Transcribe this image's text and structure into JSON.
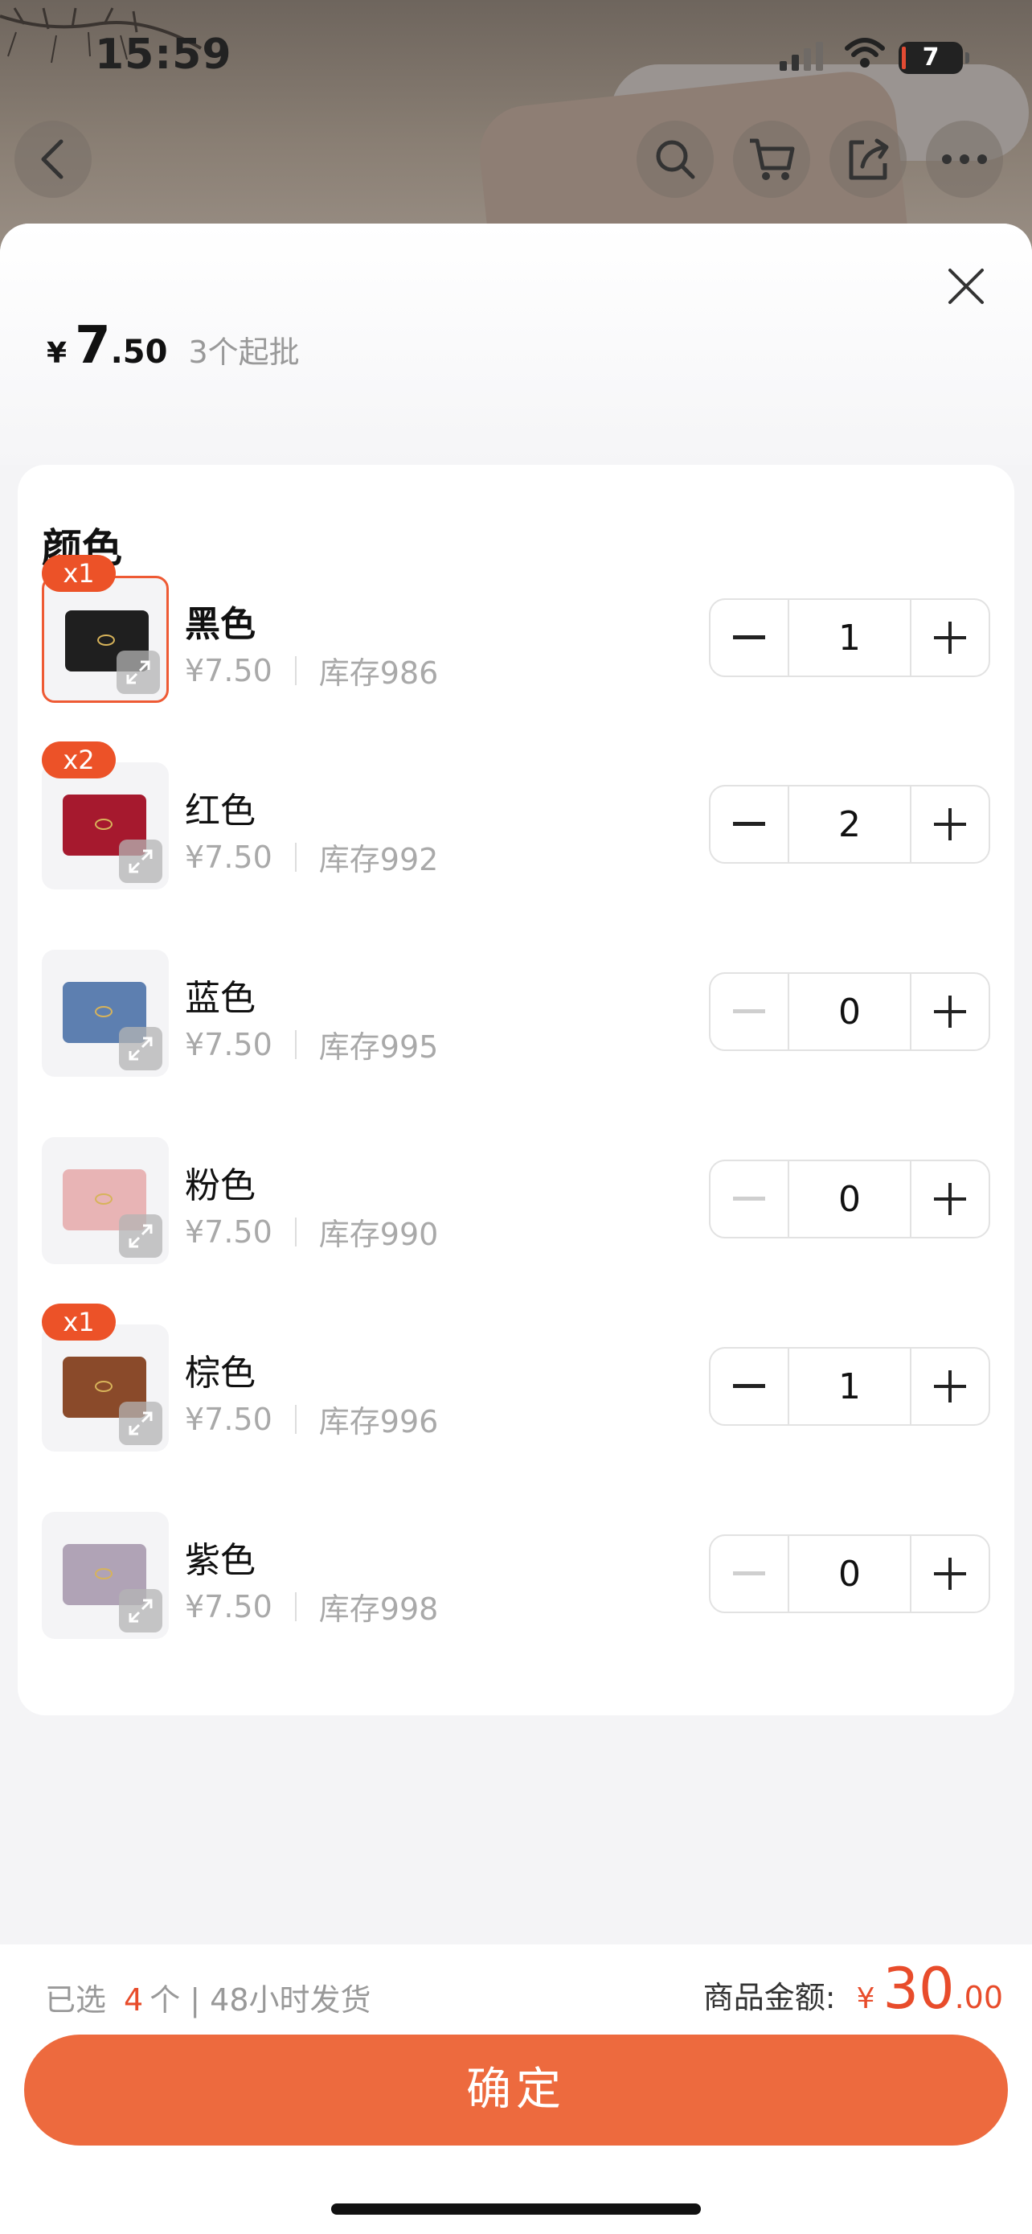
{
  "status_bar": {
    "time": "15:59",
    "battery": "7"
  },
  "header": {
    "icons": [
      "back-icon",
      "search-icon",
      "cart-icon",
      "share-icon",
      "more-icon"
    ]
  },
  "sheet": {
    "price_symbol": "¥",
    "price_integer": "7",
    "price_decimal": ".50",
    "min_order": "3个起批",
    "section_title": "颜色"
  },
  "variants": [
    {
      "name": "黑色",
      "price": "¥7.50",
      "stock": "库存986",
      "qty": "1",
      "badge": "x1",
      "color": "#1f1f1f",
      "selected": true
    },
    {
      "name": "红色",
      "price": "¥7.50",
      "stock": "库存992",
      "qty": "2",
      "badge": "x2",
      "color": "#a6192e",
      "selected": false
    },
    {
      "name": "蓝色",
      "price": "¥7.50",
      "stock": "库存995",
      "qty": "0",
      "badge": "",
      "color": "#5d7fb0",
      "selected": false
    },
    {
      "name": "粉色",
      "price": "¥7.50",
      "stock": "库存990",
      "qty": "0",
      "badge": "",
      "color": "#e8b4b5",
      "selected": false
    },
    {
      "name": "棕色",
      "price": "¥7.50",
      "stock": "库存996",
      "qty": "1",
      "badge": "x1",
      "color": "#8a4a2a",
      "selected": false
    },
    {
      "name": "紫色",
      "price": "¥7.50",
      "stock": "库存998",
      "qty": "0",
      "badge": "",
      "color": "#b0a3b6",
      "selected": false
    }
  ],
  "footer": {
    "selected_prefix": "已选",
    "selected_count": "4",
    "selected_suffix": "个 | 48小时发货",
    "total_label": "商品金额:",
    "total_symbol": "¥",
    "total_integer": "30",
    "total_decimal": ".00",
    "confirm_label": "确定"
  },
  "colors": {
    "accent": "#ed6a3e",
    "badge": "#ec5228",
    "price": "#e84c2b"
  }
}
